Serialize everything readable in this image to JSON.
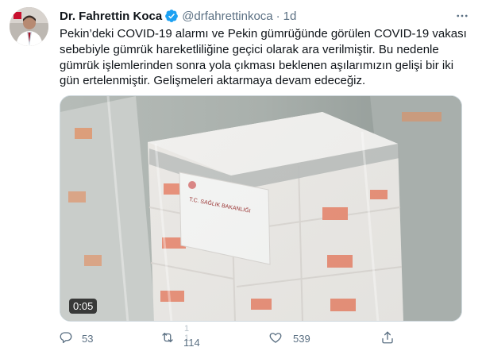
{
  "tweet": {
    "author_name": "Dr. Fahrettin Koca",
    "handle": "@drfahrettinkoca",
    "separator": "·",
    "time": "1d",
    "text": "Pekin’deki COVID-19 alarmı ve Pekin gümrüğünde görülen COVID-19 vakası sebebiyle gümrük hareketliliğine geçici olarak ara verilmiştir. Bu nedenle gümrük işlemlerinden sonra yola çıkması beklenen aşılarımızın gelişi bir iki gün ertelenmiştir. Gelişmeleri aktarmaya devam edeceğiz.",
    "video": {
      "timestamp": "0:05",
      "label_lines": [
        "T.C. SAĞLIK BAKANLIĞI"
      ]
    },
    "actions": {
      "reply_count": "53",
      "retweet_count": "114",
      "retweet_ghost": "1 1",
      "like_count": "539"
    }
  },
  "icons": {
    "verified": "verified-badge-icon",
    "more": "more-options-icon",
    "reply": "reply-icon",
    "retweet": "retweet-icon",
    "like": "heart-icon",
    "share": "share-icon"
  },
  "colors": {
    "verified_blue": "#1da1f2",
    "secondary_text": "#5b7083",
    "primary_text": "#0f1419"
  }
}
